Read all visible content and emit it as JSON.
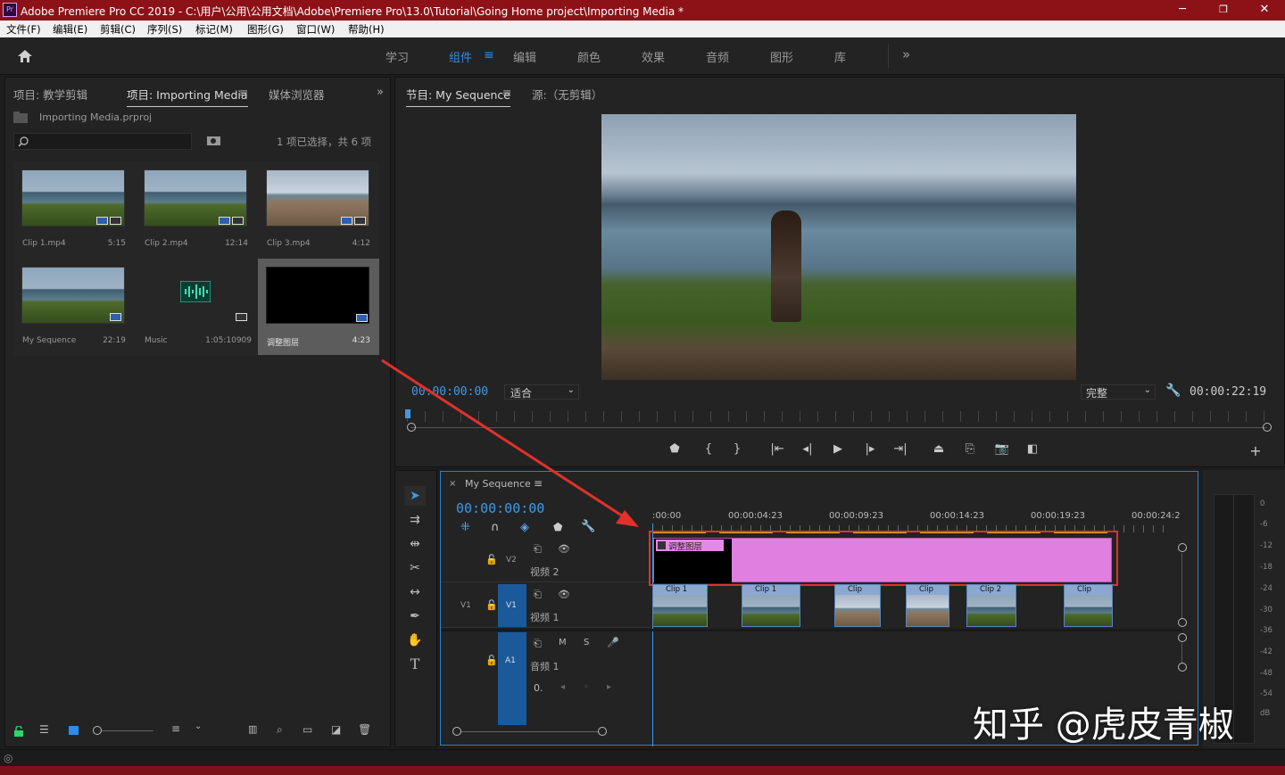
{
  "titlebar": {
    "logo": "Pr",
    "title": "Adobe Premiere Pro CC 2019 - C:\\用户\\公用\\公用文档\\Adobe\\Premiere Pro\\13.0\\Tutorial\\Going Home project\\Importing Media *",
    "minimize": "─",
    "restore": "❐",
    "close": "✕"
  },
  "menubar": [
    "文件(F)",
    "编辑(E)",
    "剪辑(C)",
    "序列(S)",
    "标记(M)",
    "图形(G)",
    "窗口(W)",
    "帮助(H)"
  ],
  "workspaces": {
    "items": [
      "学习",
      "组件",
      "编辑",
      "颜色",
      "效果",
      "音频",
      "图形",
      "库"
    ],
    "active": "组件",
    "more": "»",
    "active_color": "#2d8ceb"
  },
  "project_panel": {
    "tabs": [
      "项目: 教学剪辑",
      "项目: Importing Media",
      "媒体浏览器"
    ],
    "active_tab": "项目: Importing Media",
    "more": "»",
    "file": "Importing Media.prproj",
    "search_placeholder": "",
    "selection_status": "1 项已选择，共 6 项",
    "items": [
      {
        "name": "Clip 1.mp4",
        "duration": "5:15"
      },
      {
        "name": "Clip 2.mp4",
        "duration": "12:14"
      },
      {
        "name": "Clip 3.mp4",
        "duration": "4:12"
      },
      {
        "name": "My Sequence",
        "duration": "22:19"
      },
      {
        "name": "Music",
        "duration": "1:05:10909"
      },
      {
        "name": "调整图层",
        "duration": "4:23"
      }
    ],
    "selected_item": "调整图层"
  },
  "program_monitor": {
    "tabs": [
      "节目: My Sequence",
      "源:（无剪辑）"
    ],
    "active_tab": "节目: My Sequence",
    "current_timecode": "00:00:00:00",
    "fit": "适合",
    "quality": "完整",
    "duration": "00:00:22:19",
    "add": "+"
  },
  "timeline": {
    "close": "×",
    "sequence_name": "My Sequence",
    "timecode": "00:00:00:00",
    "ruler_labels": [
      ":00:00",
      "00:00:04:23",
      "00:00:09:23",
      "00:00:14:23",
      "00:00:19:23",
      "00:00:24:2"
    ],
    "tracks": [
      {
        "id": "V2",
        "name": "视频 2"
      },
      {
        "id": "V1",
        "name": "视频 1",
        "source": "V1"
      },
      {
        "id": "A1",
        "name": "音频 1",
        "source": "A1"
      }
    ],
    "audio_buttons": {
      "mute": "M",
      "solo": "S"
    },
    "volume": "0.",
    "adjustment_clip": "调整图层",
    "v1_clips": [
      "Clip 1",
      "Clip 1",
      "Clip",
      "Clip",
      "Clip 2",
      "Clip"
    ],
    "highlight_color": "#e0312b"
  },
  "audio_meter": {
    "ticks": [
      "0",
      "-6",
      "-12",
      "-18",
      "-24",
      "-30",
      "-36",
      "-42",
      "-48",
      "-54",
      "dB"
    ]
  },
  "watermark": "知乎 @虎皮青椒"
}
